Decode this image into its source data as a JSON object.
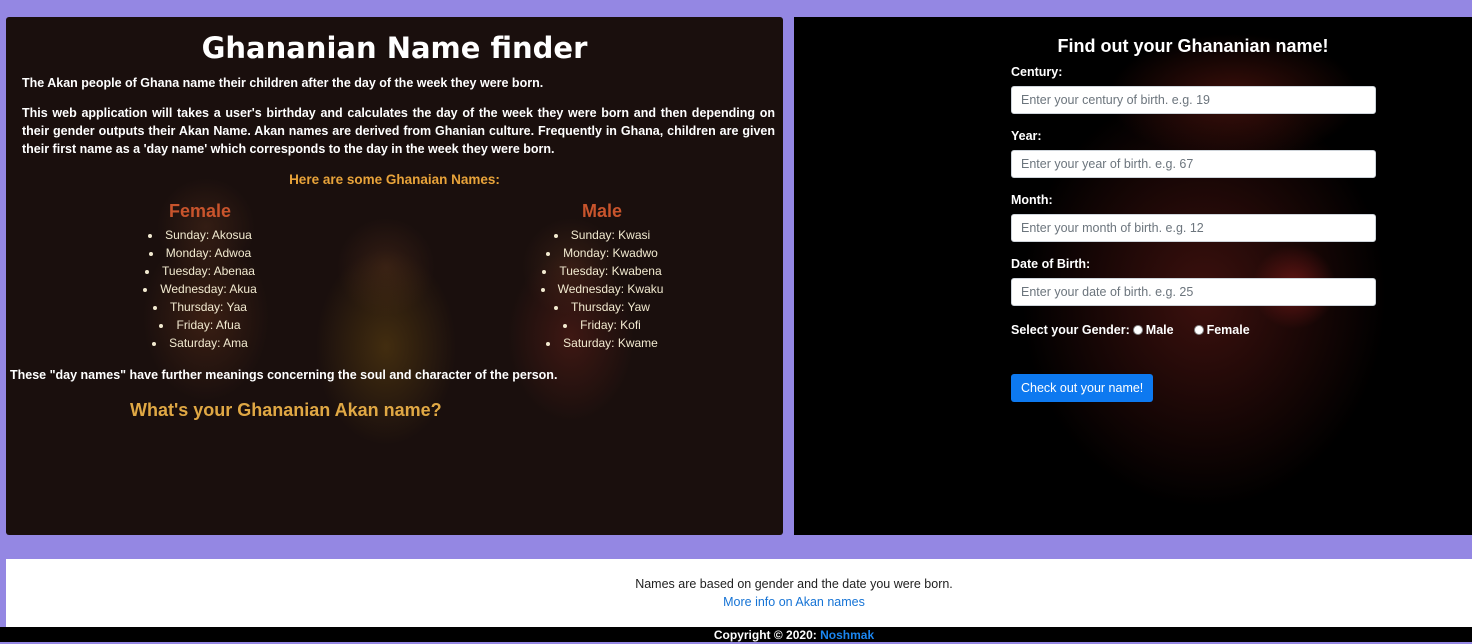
{
  "left_panel": {
    "title": "Ghananian Name finder",
    "intro_1": "The Akan people of Ghana name their children after the day of the week they were born.",
    "intro_2": "This web application will takes a user's birthday and calculates the day of the week they were born and then depending on their gender outputs their Akan Name. Akan names are derived from Ghanian culture. Frequently in Ghana, children are given their first name as a 'day name' which corresponds to the day in the week they were born.",
    "names_heading": "Here are some Ghanaian Names:",
    "female": {
      "heading": "Female",
      "items": [
        "Sunday: Akosua",
        "Monday: Adwoa",
        "Tuesday: Abenaa",
        "Wednesday: Akua",
        "Thursday: Yaa",
        "Friday: Afua",
        "Saturday: Ama"
      ]
    },
    "male": {
      "heading": "Male",
      "items": [
        "Sunday: Kwasi",
        "Monday: Kwadwo",
        "Tuesday: Kwabena",
        "Wednesday: Kwaku",
        "Thursday: Yaw",
        "Friday: Kofi",
        "Saturday: Kwame"
      ]
    },
    "meaning_note": "These \"day names\" have further meanings concerning the soul and character of the person.",
    "cta": "What's your Ghananian Akan name?"
  },
  "form": {
    "title": "Find out your Ghananian name!",
    "century_label": "Century:",
    "century_placeholder": "Enter your century of birth. e.g. 19",
    "year_label": "Year:",
    "year_placeholder": "Enter your year of birth. e.g. 67",
    "month_label": "Month:",
    "month_placeholder": "Enter your month of birth. e.g. 12",
    "date_label": "Date of Birth:",
    "date_placeholder": "Enter your date of birth. e.g. 25",
    "gender_label": "Select your Gender:",
    "gender_male": "Male",
    "gender_female": "Female",
    "submit_label": "Check out your name!"
  },
  "footer": {
    "note": "Names are based on gender and the date you were born.",
    "link": "More info on Akan names",
    "copyright_prefix": "Copyright © 2020:",
    "author": "Noshmak"
  },
  "colors": {
    "page_bg": "#9487e3",
    "accent_orange": "#e8a33a",
    "accent_red": "#c8542c",
    "button_blue": "#0d79f0"
  }
}
